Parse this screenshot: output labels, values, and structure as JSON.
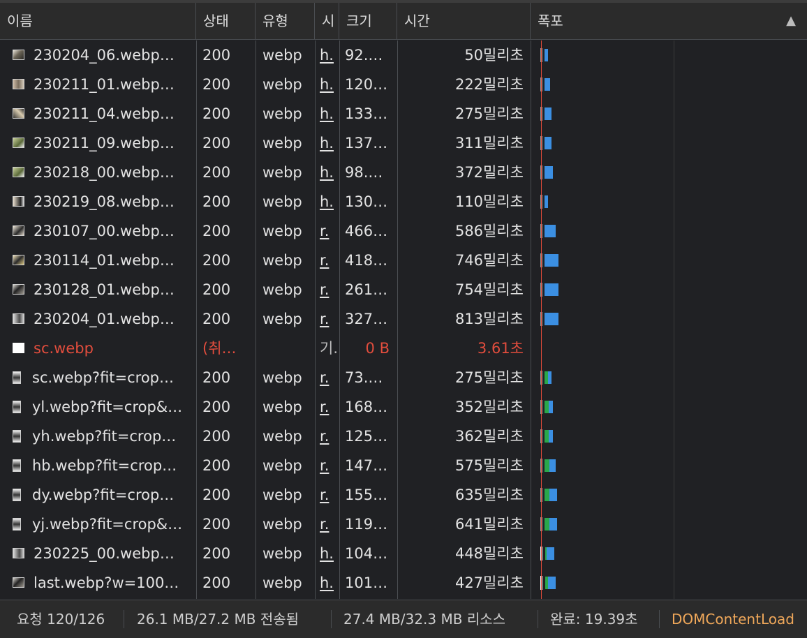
{
  "header": {
    "name": "이름",
    "status": "상태",
    "type": "유형",
    "initiator": "시",
    "size": "크기",
    "time": "시간",
    "waterfall": "폭포",
    "sort_icon": "triangle-up-icon"
  },
  "colors": {
    "background": "#202124",
    "header_bg": "#2b2b2b",
    "error_text": "#e24d3d",
    "waterfall_blue": "#3b8fe2",
    "waterfall_green": "#2aa84a",
    "waterfall_marker": "#e04b3a",
    "dom_content_loaded": "#f0a85a"
  },
  "rows": [
    {
      "name": "230204_06.webp…",
      "status": "200",
      "type": "webp",
      "initiator": "h.",
      "size": "92.…",
      "time": "50밀리초"
    },
    {
      "name": "230211_01.webp…",
      "status": "200",
      "type": "webp",
      "initiator": "h.",
      "size": "120…",
      "time": "222밀리초"
    },
    {
      "name": "230211_04.webp…",
      "status": "200",
      "type": "webp",
      "initiator": "h.",
      "size": "133…",
      "time": "275밀리초"
    },
    {
      "name": "230211_09.webp…",
      "status": "200",
      "type": "webp",
      "initiator": "h.",
      "size": "137…",
      "time": "311밀리초"
    },
    {
      "name": "230218_00.webp…",
      "status": "200",
      "type": "webp",
      "initiator": "h.",
      "size": "98.…",
      "time": "372밀리초"
    },
    {
      "name": "230219_08.webp…",
      "status": "200",
      "type": "webp",
      "initiator": "h.",
      "size": "130…",
      "time": "110밀리초"
    },
    {
      "name": "230107_00.webp…",
      "status": "200",
      "type": "webp",
      "initiator": "r.",
      "size": "466…",
      "time": "586밀리초"
    },
    {
      "name": "230114_01.webp…",
      "status": "200",
      "type": "webp",
      "initiator": "r.",
      "size": "418…",
      "time": "746밀리초"
    },
    {
      "name": "230128_01.webp…",
      "status": "200",
      "type": "webp",
      "initiator": "r.",
      "size": "261…",
      "time": "754밀리초"
    },
    {
      "name": "230204_01.webp…",
      "status": "200",
      "type": "webp",
      "initiator": "r.",
      "size": "327…",
      "time": "813밀리초"
    },
    {
      "name": "sc.webp",
      "status": "(취…",
      "type": "",
      "initiator": "기.",
      "size": "0 B",
      "time": "3.61초"
    },
    {
      "name": "sc.webp?fit=crop…",
      "status": "200",
      "type": "webp",
      "initiator": "r.",
      "size": "73.…",
      "time": "275밀리초"
    },
    {
      "name": "yl.webp?fit=crop&…",
      "status": "200",
      "type": "webp",
      "initiator": "r.",
      "size": "168…",
      "time": "352밀리초"
    },
    {
      "name": "yh.webp?fit=crop…",
      "status": "200",
      "type": "webp",
      "initiator": "r.",
      "size": "125…",
      "time": "362밀리초"
    },
    {
      "name": "hb.webp?fit=crop…",
      "status": "200",
      "type": "webp",
      "initiator": "r.",
      "size": "147…",
      "time": "575밀리초"
    },
    {
      "name": "dy.webp?fit=crop…",
      "status": "200",
      "type": "webp",
      "initiator": "r.",
      "size": "155…",
      "time": "635밀리초"
    },
    {
      "name": "yj.webp?fit=crop&…",
      "status": "200",
      "type": "webp",
      "initiator": "r.",
      "size": "119…",
      "time": "641밀리초"
    },
    {
      "name": "230225_00.webp…",
      "status": "200",
      "type": "webp",
      "initiator": "h.",
      "size": "104…",
      "time": "448밀리초"
    },
    {
      "name": "last.webp?w=100…",
      "status": "200",
      "type": "webp",
      "initiator": "h.",
      "size": "101…",
      "time": "427밀리초"
    }
  ],
  "footer": {
    "requests": "요청 120/126",
    "transferred": "26.1 MB/27.2 MB 전송됨",
    "resources": "27.4 MB/32.3 MB 리소스",
    "finish": "완료: 19.39초",
    "dom_content_loaded": "DOMContentLoad"
  }
}
